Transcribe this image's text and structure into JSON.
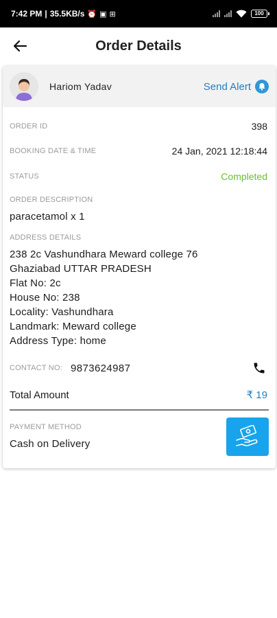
{
  "statusbar": {
    "time": "7:42 PM",
    "speed": "35.5KB/s",
    "battery": "100"
  },
  "appbar": {
    "title": "Order Details"
  },
  "customer": {
    "name": "Hariom Yadav",
    "send_alert": "Send Alert"
  },
  "order": {
    "id_label": "ORDER ID",
    "id_value": "398",
    "date_label": "BOOKING DATE & TIME",
    "date_value": "24 Jan, 2021 12:18:44",
    "status_label": "STATUS",
    "status_value": "Completed",
    "description_label": "ORDER DESCRIPTION",
    "description_value": "paracetamol x 1"
  },
  "address": {
    "label": "ADDRESS DETAILS",
    "lines": [
      "238 2c Vashundhara Meward college 76",
      "Ghaziabad UTTAR PRADESH",
      "Flat No: 2c",
      "House No: 238",
      "Locality: Vashundhara",
      "Landmark: Meward college",
      "Address Type: home"
    ]
  },
  "contact": {
    "label": "CONTACT NO:",
    "value": "9873624987"
  },
  "total": {
    "label": "Total Amount",
    "value": "₹ 19"
  },
  "payment": {
    "label": "PAYMENT METHOD",
    "value": "Cash on Delivery"
  },
  "colors": {
    "accent": "#1e7fc4",
    "status_completed": "#63c132",
    "payment_button": "#17a4ec"
  },
  "icons": [
    "back-arrow-icon",
    "avatar-icon",
    "bell-icon",
    "phone-icon",
    "cash-hand-icon"
  ]
}
